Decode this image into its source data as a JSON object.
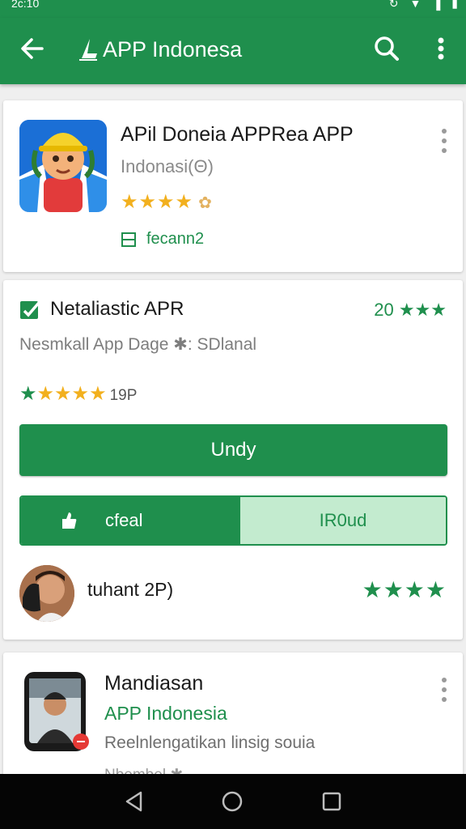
{
  "status_bar": {
    "time": "2c:10"
  },
  "app_bar": {
    "title": "APP Indonesa"
  },
  "app_card": {
    "title": "APil Doneia APPRea APP",
    "developer": "Indonasi(Θ)",
    "stars": "★★★★",
    "half_star": "✿",
    "install_label": "fecann2"
  },
  "detail_card": {
    "heading": "Netaliastic APR",
    "rating": "20 ★★★",
    "subtitle": "Nesmkall App Dage ✱: SDlanal",
    "stars_green": "★",
    "stars_gold": "★★★★",
    "rating_count": "19P",
    "primary_button": "Undy",
    "segment_left": "cfeal",
    "segment_right": "IR0ud",
    "review": {
      "name": "tuhant 2P)",
      "stars": "★★★★"
    }
  },
  "list_card": {
    "title": "Mandiasan",
    "developer": "APP Indonesia",
    "description": "Reelnlengatikan linsig souia",
    "extra": "Nbembel ✱"
  },
  "colors": {
    "accent": "#1f8f4d",
    "star_gold": "#f2b01e",
    "segment_light": "#c3ebcf"
  },
  "icons": [
    "back-arrow-icon",
    "app-logo-icon",
    "search-icon",
    "more-vert-icon",
    "install-icon",
    "verified-icon",
    "hand-icon",
    "nav-back-icon",
    "nav-home-icon",
    "nav-recent-icon"
  ]
}
